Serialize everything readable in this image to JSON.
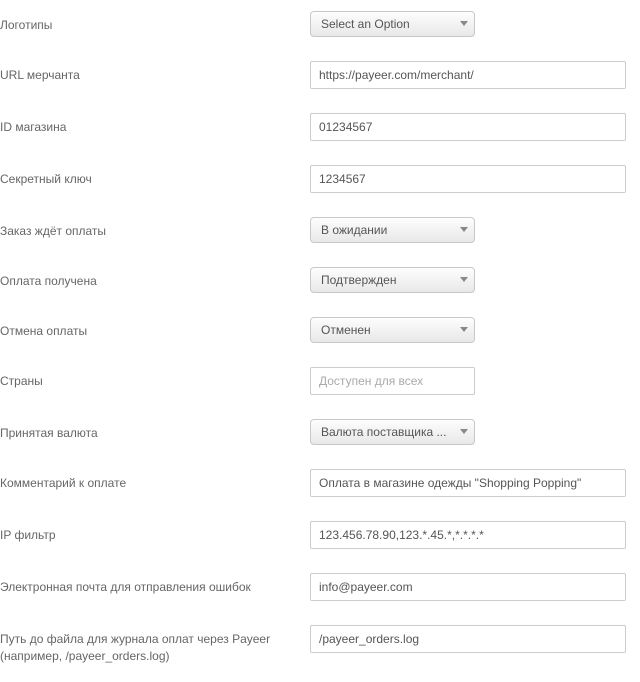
{
  "fields": {
    "logos": {
      "label": "Логотипы",
      "value": "Select an Option"
    },
    "merchant_url": {
      "label": "URL мерчанта",
      "value": "https://payeer.com/merchant/"
    },
    "shop_id": {
      "label": "ID магазина",
      "value": "01234567"
    },
    "secret_key": {
      "label": "Секретный ключ",
      "value": "1234567"
    },
    "pending": {
      "label": "Заказ ждёт оплаты",
      "value": "В ожидании"
    },
    "paid": {
      "label": "Оплата получена",
      "value": "Подтвержден"
    },
    "cancelled": {
      "label": "Отмена оплаты",
      "value": "Отменен"
    },
    "countries": {
      "label": "Страны",
      "placeholder": "Доступен для всех"
    },
    "currency": {
      "label": "Принятая валюта",
      "value": "Валюта поставщика ..."
    },
    "comment": {
      "label": "Комментарий к оплате",
      "value": "Оплата в магазине одежды \"Shopping Popping\""
    },
    "ip_filter": {
      "label": "IP фильтр",
      "value": "123.456.78.90,123.*.45.*,*.*.*.*"
    },
    "error_email": {
      "label": "Электронная почта для отправления ошибок",
      "value": "info@payeer.com"
    },
    "log_path": {
      "label": "Путь до файла для журнала оплат через Payeer (например, /payeer_orders.log)",
      "value": "/payeer_orders.log"
    }
  }
}
